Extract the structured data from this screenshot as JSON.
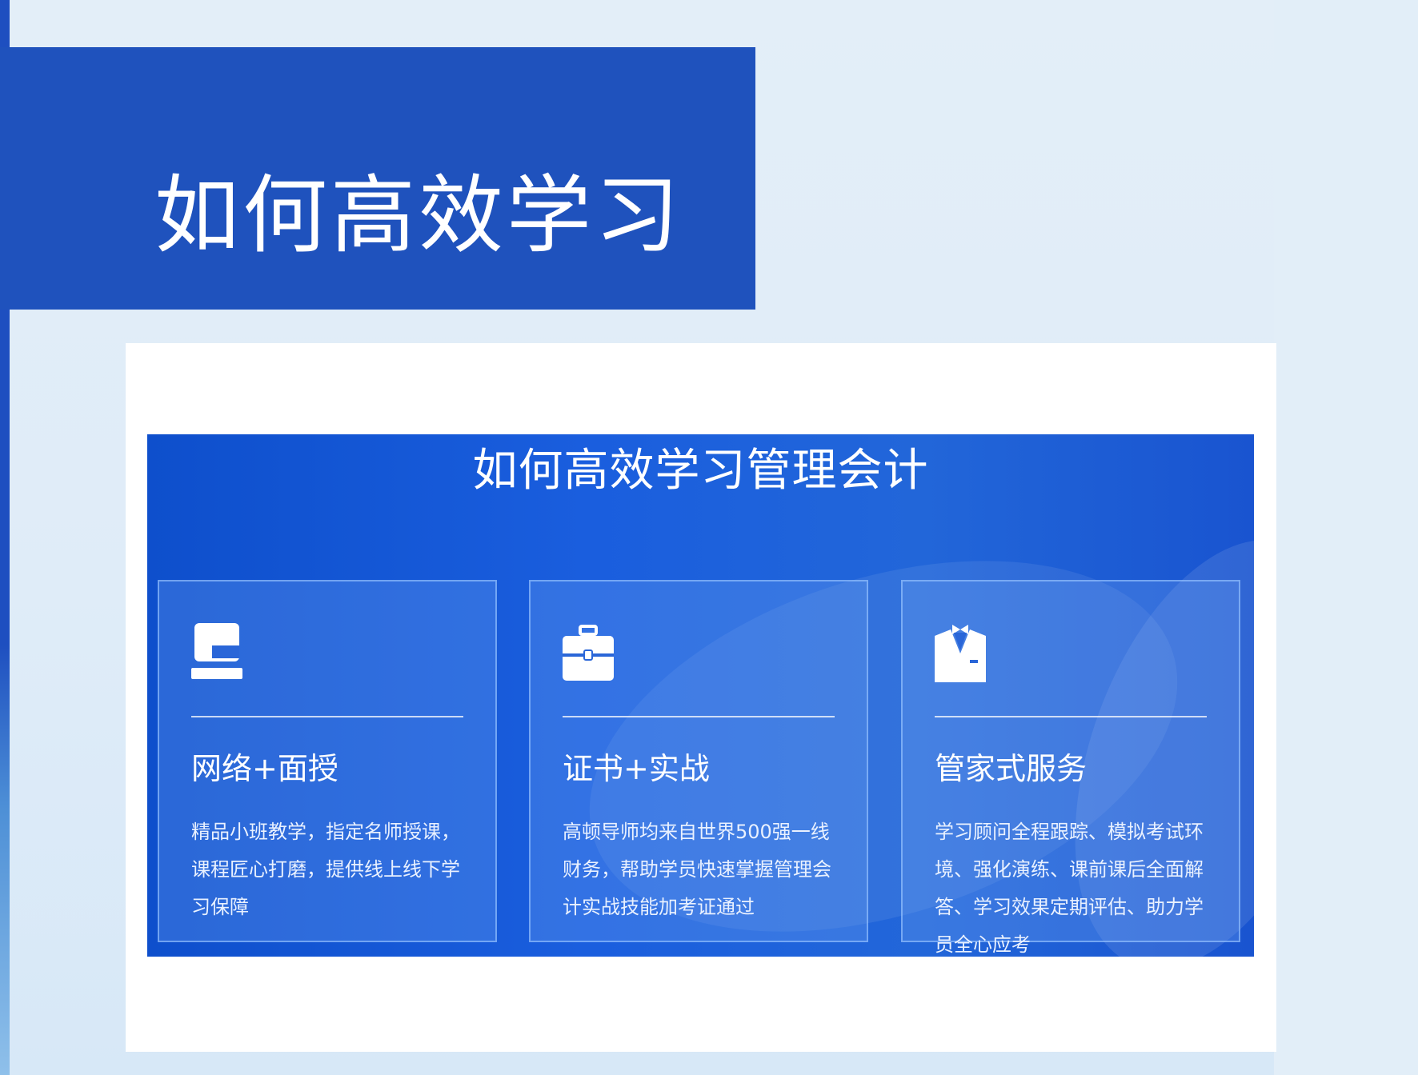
{
  "banner": {
    "title": "如何高效学习"
  },
  "panel": {
    "title": "如何高效学习管理会计"
  },
  "cards": [
    {
      "icon": "monitor-stand-icon",
      "title": "网络+面授",
      "description": "精品小班教学，指定名师授课，课程匠心打磨，提供线上线下学习保障"
    },
    {
      "icon": "briefcase-icon",
      "title": "证书+实战",
      "description": "高顿导师均来自世界500强一线财务，帮助学员快速掌握管理会计实战技能加考证通过"
    },
    {
      "icon": "butler-suit-icon",
      "title": "管家式服务",
      "description": "学习顾问全程跟踪、模拟考试环境、强化演练、课前课后全面解答、学习效果定期评估、助力学员全心应考"
    }
  ],
  "colors": {
    "banner": "#1f52bd",
    "panel": "#1a5ede",
    "background": "#e3eef8"
  }
}
